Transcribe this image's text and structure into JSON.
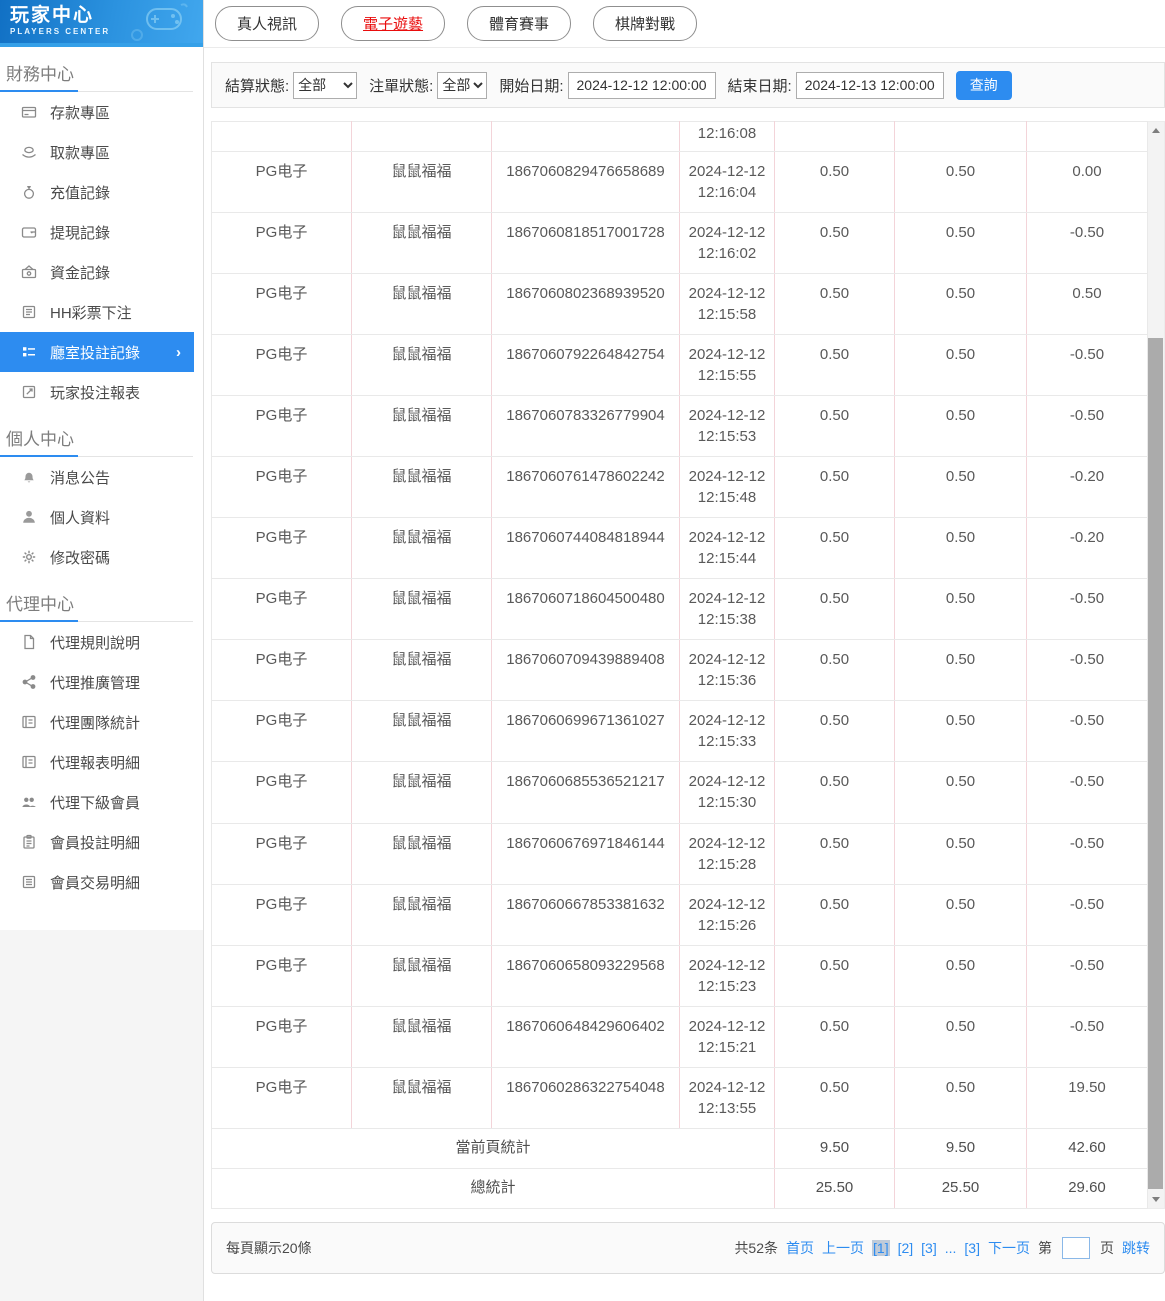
{
  "colors": {
    "accent_blue": "#2d8cf0",
    "active_tab_red": "#e90d0d",
    "table_divider_pink": "#f3d4d9"
  },
  "sidebar": {
    "logo": {
      "title": "玩家中心",
      "subtitle": "PLAYERS CENTER"
    },
    "sections": [
      {
        "title": "財務中心",
        "items": [
          {
            "label": "存款專區"
          },
          {
            "label": "取款專區"
          },
          {
            "label": "充值記錄"
          },
          {
            "label": "提現記錄"
          },
          {
            "label": "資金記錄"
          },
          {
            "label": "HH彩票下注"
          },
          {
            "label": "廳室投註記錄",
            "active": true,
            "chevron": "›"
          },
          {
            "label": "玩家投注報表"
          }
        ]
      },
      {
        "title": "個人中心",
        "items": [
          {
            "label": "消息公告"
          },
          {
            "label": "個人資料"
          },
          {
            "label": "修改密碼"
          }
        ]
      },
      {
        "title": "代理中心",
        "items": [
          {
            "label": "代理規則說明"
          },
          {
            "label": "代理推廣管理"
          },
          {
            "label": "代理團隊統計"
          },
          {
            "label": "代理報表明細"
          },
          {
            "label": "代理下級會員"
          },
          {
            "label": "會員投註明細"
          },
          {
            "label": "會員交易明細"
          }
        ]
      }
    ]
  },
  "tabs": [
    {
      "label": "真人視訊",
      "active": false
    },
    {
      "label": "電子遊藝",
      "active": true
    },
    {
      "label": "體育賽事",
      "active": false
    },
    {
      "label": "棋牌對戰",
      "active": false
    }
  ],
  "filters": {
    "settle_status_label": "結算狀態:",
    "settle_status_value": "全部",
    "order_status_label": "注單狀態:",
    "order_status_value": "全部",
    "start_date_label": "開始日期:",
    "start_date_value": "2024-12-12 12:00:00",
    "end_date_label": "結束日期:",
    "end_date_value": "2024-12-13 12:00:00",
    "search_label": "查詢"
  },
  "table": {
    "partial_top_time": "12:16:08",
    "rows": [
      {
        "platform": "PG电子",
        "game": "鼠鼠福福",
        "order_id": "1867060829476658689",
        "date": "2024-12-12",
        "time": "12:16:04",
        "bet": "0.50",
        "valid_bet": "0.50",
        "profit": "0.00"
      },
      {
        "platform": "PG电子",
        "game": "鼠鼠福福",
        "order_id": "1867060818517001728",
        "date": "2024-12-12",
        "time": "12:16:02",
        "bet": "0.50",
        "valid_bet": "0.50",
        "profit": "-0.50"
      },
      {
        "platform": "PG电子",
        "game": "鼠鼠福福",
        "order_id": "1867060802368939520",
        "date": "2024-12-12",
        "time": "12:15:58",
        "bet": "0.50",
        "valid_bet": "0.50",
        "profit": "0.50"
      },
      {
        "platform": "PG电子",
        "game": "鼠鼠福福",
        "order_id": "1867060792264842754",
        "date": "2024-12-12",
        "time": "12:15:55",
        "bet": "0.50",
        "valid_bet": "0.50",
        "profit": "-0.50"
      },
      {
        "platform": "PG电子",
        "game": "鼠鼠福福",
        "order_id": "1867060783326779904",
        "date": "2024-12-12",
        "time": "12:15:53",
        "bet": "0.50",
        "valid_bet": "0.50",
        "profit": "-0.50"
      },
      {
        "platform": "PG电子",
        "game": "鼠鼠福福",
        "order_id": "1867060761478602242",
        "date": "2024-12-12",
        "time": "12:15:48",
        "bet": "0.50",
        "valid_bet": "0.50",
        "profit": "-0.20"
      },
      {
        "platform": "PG电子",
        "game": "鼠鼠福福",
        "order_id": "1867060744084818944",
        "date": "2024-12-12",
        "time": "12:15:44",
        "bet": "0.50",
        "valid_bet": "0.50",
        "profit": "-0.20"
      },
      {
        "platform": "PG电子",
        "game": "鼠鼠福福",
        "order_id": "1867060718604500480",
        "date": "2024-12-12",
        "time": "12:15:38",
        "bet": "0.50",
        "valid_bet": "0.50",
        "profit": "-0.50"
      },
      {
        "platform": "PG电子",
        "game": "鼠鼠福福",
        "order_id": "1867060709439889408",
        "date": "2024-12-12",
        "time": "12:15:36",
        "bet": "0.50",
        "valid_bet": "0.50",
        "profit": "-0.50"
      },
      {
        "platform": "PG电子",
        "game": "鼠鼠福福",
        "order_id": "1867060699671361027",
        "date": "2024-12-12",
        "time": "12:15:33",
        "bet": "0.50",
        "valid_bet": "0.50",
        "profit": "-0.50"
      },
      {
        "platform": "PG电子",
        "game": "鼠鼠福福",
        "order_id": "1867060685536521217",
        "date": "2024-12-12",
        "time": "12:15:30",
        "bet": "0.50",
        "valid_bet": "0.50",
        "profit": "-0.50"
      },
      {
        "platform": "PG电子",
        "game": "鼠鼠福福",
        "order_id": "1867060676971846144",
        "date": "2024-12-12",
        "time": "12:15:28",
        "bet": "0.50",
        "valid_bet": "0.50",
        "profit": "-0.50"
      },
      {
        "platform": "PG电子",
        "game": "鼠鼠福福",
        "order_id": "1867060667853381632",
        "date": "2024-12-12",
        "time": "12:15:26",
        "bet": "0.50",
        "valid_bet": "0.50",
        "profit": "-0.50"
      },
      {
        "platform": "PG电子",
        "game": "鼠鼠福福",
        "order_id": "1867060658093229568",
        "date": "2024-12-12",
        "time": "12:15:23",
        "bet": "0.50",
        "valid_bet": "0.50",
        "profit": "-0.50"
      },
      {
        "platform": "PG电子",
        "game": "鼠鼠福福",
        "order_id": "1867060648429606402",
        "date": "2024-12-12",
        "time": "12:15:21",
        "bet": "0.50",
        "valid_bet": "0.50",
        "profit": "-0.50"
      },
      {
        "platform": "PG电子",
        "game": "鼠鼠福福",
        "order_id": "1867060286322754048",
        "date": "2024-12-12",
        "time": "12:13:55",
        "bet": "0.50",
        "valid_bet": "0.50",
        "profit": "19.50"
      }
    ],
    "summary": [
      {
        "label": "當前頁統計",
        "bet": "9.50",
        "valid_bet": "9.50",
        "profit": "42.60"
      },
      {
        "label": "總統計",
        "bet": "25.50",
        "valid_bet": "25.50",
        "profit": "29.60"
      }
    ]
  },
  "pagination": {
    "page_size_text": "每頁顯示20條",
    "total_text": "共52条",
    "first": "首页",
    "prev": "上一页",
    "pages": [
      "[1]",
      "[2]",
      "[3]",
      "...",
      "[3]"
    ],
    "next": "下一页",
    "jump_prefix": "第",
    "jump_suffix": "页",
    "jump_action": "跳转"
  }
}
